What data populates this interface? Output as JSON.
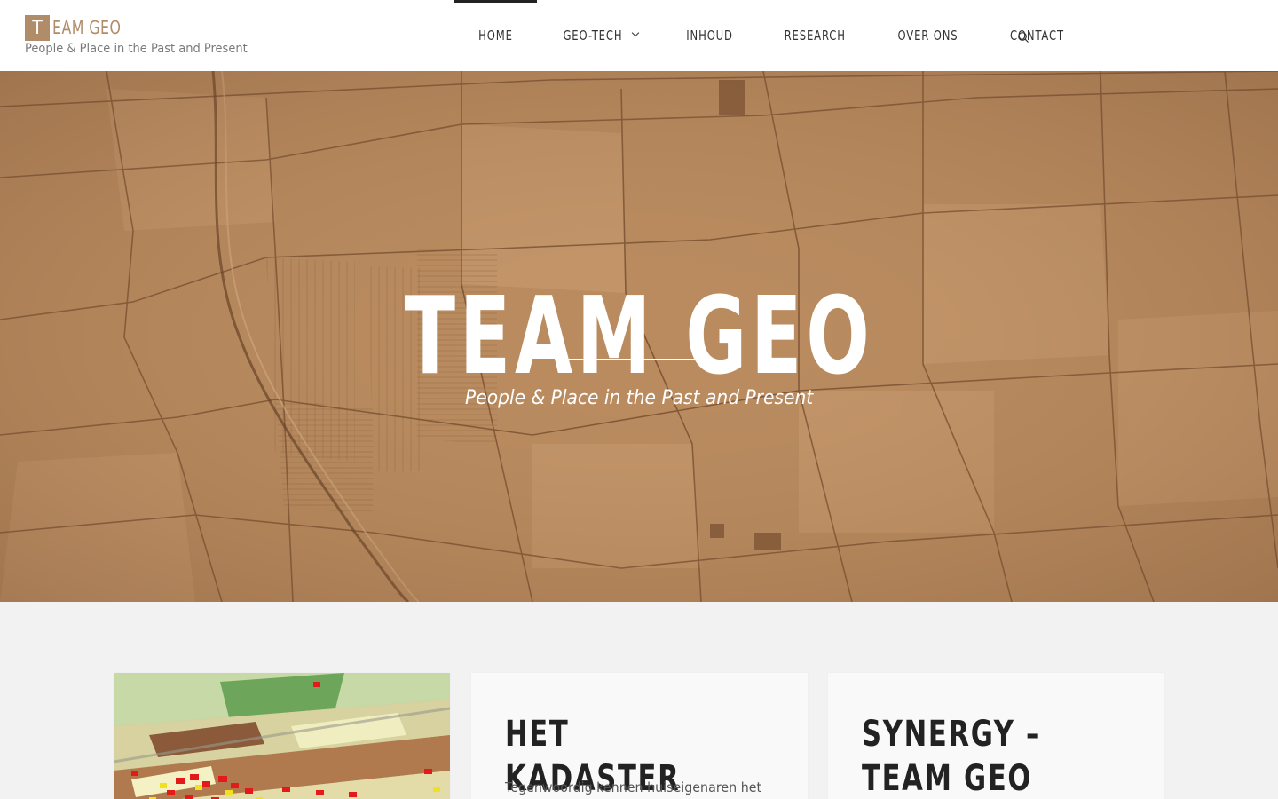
{
  "header": {
    "logo_initial": "T",
    "logo_rest": "EAM GEO",
    "tagline": "People & Place in the Past and Present",
    "brand_color": "#b08c69"
  },
  "nav": {
    "items": [
      {
        "label": "HOME",
        "active": true
      },
      {
        "label": "GEO-TECH",
        "has_dropdown": true
      },
      {
        "label": "INHOUD"
      },
      {
        "label": "RESEARCH"
      },
      {
        "label": "OVER ONS"
      },
      {
        "label": "CONTACT"
      }
    ],
    "search_icon": "search-icon"
  },
  "hero": {
    "title": "TEAM GEO",
    "subtitle": "People & Place in the Past and Present",
    "background": "sepia-cadastral-map",
    "tint_color": "#b8895d"
  },
  "cards": [
    {
      "image": "3d-landuse-map"
    },
    {
      "title": "HET KADASTER",
      "excerpt": "Tegenwoordig kennen huiseigenaren het"
    },
    {
      "title": "SYNERGY – TEAM GEO"
    }
  ]
}
